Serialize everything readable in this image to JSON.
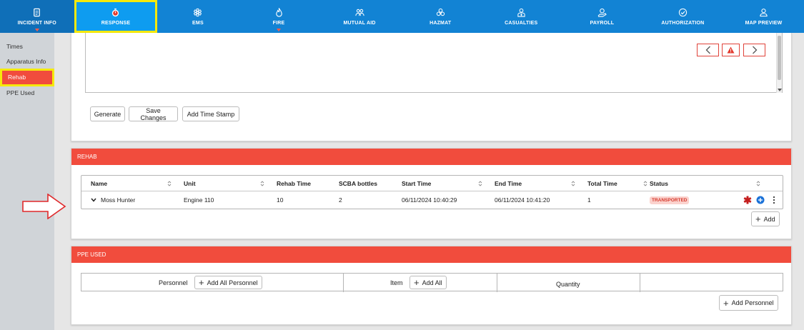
{
  "nav": {
    "items": [
      {
        "label": "INCIDENT INFO",
        "icon": "document-icon"
      },
      {
        "label": "RESPONSE",
        "icon": "stopwatch-icon"
      },
      {
        "label": "EMS",
        "icon": "star-of-life-icon"
      },
      {
        "label": "FIRE",
        "icon": "flame-icon"
      },
      {
        "label": "MUTUAL AID",
        "icon": "people-icon"
      },
      {
        "label": "HAZMAT",
        "icon": "biohazard-icon"
      },
      {
        "label": "CASUALTIES",
        "icon": "casualty-icon"
      },
      {
        "label": "PAYROLL",
        "icon": "money-hand-icon"
      },
      {
        "label": "AUTHORIZATION",
        "icon": "check-circle-icon"
      },
      {
        "label": "MAP PREVIEW",
        "icon": "map-pin-user-icon"
      }
    ],
    "active": "RESPONSE"
  },
  "sidebar": {
    "items": [
      {
        "label": "Times"
      },
      {
        "label": "Apparatus Info"
      },
      {
        "label": "Rehab"
      },
      {
        "label": "PPE Used"
      }
    ],
    "active": "Rehab"
  },
  "narrative": {
    "buttons": {
      "generate": "Generate",
      "save_changes": "Save Changes",
      "add_time_stamp": "Add Time Stamp"
    }
  },
  "rehab": {
    "title": "REHAB",
    "columns": [
      "Name",
      "Unit",
      "Rehab Time",
      "SCBA bottles",
      "Start Time",
      "End Time",
      "Total Time",
      "Status"
    ],
    "rows": [
      {
        "name": "Moss Hunter",
        "unit": "Engine 110",
        "rehab_time": "10",
        "scba_bottles": "2",
        "start_time": "06/11/2024 10:40:29",
        "end_time": "06/11/2024 10:41:20",
        "total_time": "1",
        "status": "TRANSPORTED"
      }
    ],
    "add_label": "Add"
  },
  "ppe": {
    "title": "PPE USED",
    "personnel_label": "Personnel",
    "add_all_personnel": "Add All Personnel",
    "item_label": "Item",
    "add_all": "Add All",
    "quantity_label": "Quantity",
    "add_personnel": "Add Personnel"
  },
  "colors": {
    "nav_bg": "#1283d4",
    "nav_active": "#0e9cf0",
    "header_red": "#f14c3d",
    "highlight_yellow": "#f5e90a",
    "status_badge_bg": "#fbd2cd",
    "status_badge_text": "#d63a2e"
  }
}
